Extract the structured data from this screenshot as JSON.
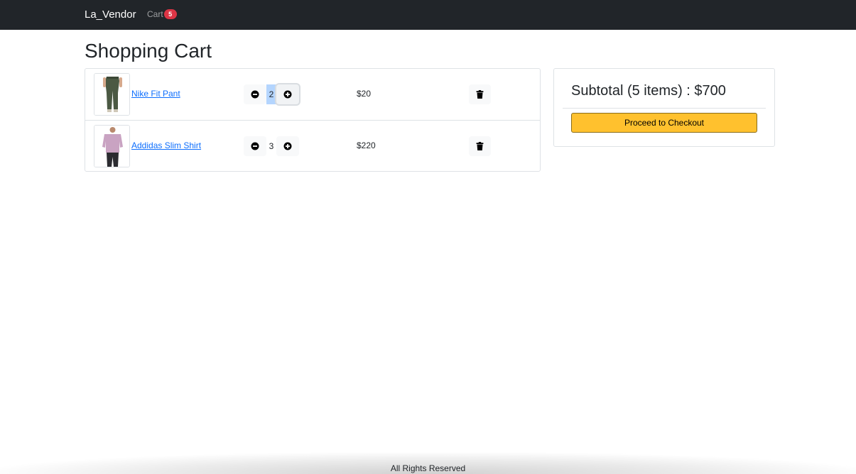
{
  "navbar": {
    "brand": "La_Vendor",
    "cart_label": "Cart",
    "cart_count": "5"
  },
  "page_title": "Shopping Cart",
  "cart_items": [
    {
      "name": "Nike Fit Pant",
      "quantity": "2",
      "price": "$20",
      "image": "pant-product-image"
    },
    {
      "name": "Addidas Slim Shirt",
      "quantity": "3",
      "price": "$220",
      "image": "shirt-product-image"
    }
  ],
  "summary": {
    "subtotal": "Subtotal (5 items) : $700",
    "checkout_label": "Proceed to Checkout"
  },
  "footer": {
    "text": "All Rights Reserved"
  },
  "icons": {
    "minus": "minus-circle-icon",
    "plus": "plus-circle-icon",
    "delete": "trash-icon"
  },
  "colors": {
    "navbar": "#212529",
    "badge": "#dc3545",
    "link": "#0d6efd",
    "checkout": "#ffc12e"
  }
}
